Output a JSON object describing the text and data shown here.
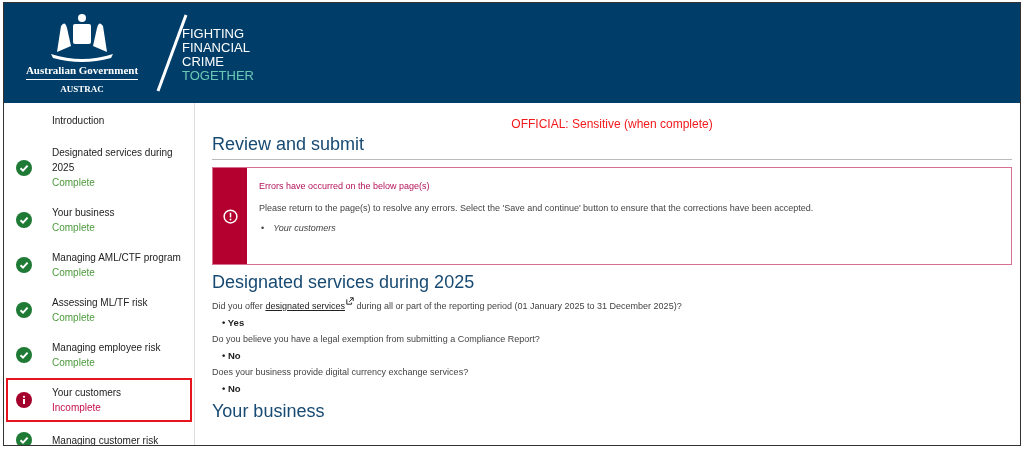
{
  "header": {
    "government": "Australian Government",
    "agency": "AUSTRAC",
    "tagline": [
      "FIGHTING",
      "FINANCIAL",
      "CRIME"
    ],
    "tagline_accent": "TOGETHER"
  },
  "sidebar": {
    "items": [
      {
        "label": "Introduction",
        "kind": "plain",
        "selected": false
      },
      {
        "label": "Designated services during 2025",
        "status": "Complete",
        "kind": "complete",
        "selected": false
      },
      {
        "label": "Your business",
        "status": "Complete",
        "kind": "complete",
        "selected": false
      },
      {
        "label": "Managing AML/CTF program",
        "status": "Complete",
        "kind": "complete",
        "selected": false
      },
      {
        "label": "Assessing ML/TF risk",
        "status": "Complete",
        "kind": "complete",
        "selected": false
      },
      {
        "label": "Managing employee risk",
        "status": "Complete",
        "kind": "complete",
        "selected": false
      },
      {
        "label": "Your customers",
        "status": "Incomplete",
        "kind": "incomplete",
        "selected": true
      },
      {
        "label": "Managing customer risk",
        "kind": "complete",
        "selected": false
      }
    ]
  },
  "classification": "OFFICIAL: Sensitive (when complete)",
  "page_title": "Review and submit",
  "error_box": {
    "title": "Errors have occurred on the below page(s)",
    "message": "Please return to the page(s) to resolve any errors. Select the 'Save and continue' button to ensure that the corrections have been accepted.",
    "marker": "•",
    "pages": [
      "Your customers"
    ]
  },
  "sections": [
    {
      "heading": "Designated services during 2025",
      "questions": [
        {
          "text_before": "Did you offer",
          "link": "designated services",
          "text_after": "during all or part of the reporting period (01 January 2025 to 31 December 2025)?",
          "answer": "• Yes"
        },
        {
          "text_before": "Do you believe you have a legal exemption from submitting a Compliance Report?",
          "answer": "• No"
        },
        {
          "text_before": "Does your business provide digital currency exchange services?",
          "answer": "• No"
        }
      ]
    },
    {
      "heading": "Your business"
    }
  ]
}
